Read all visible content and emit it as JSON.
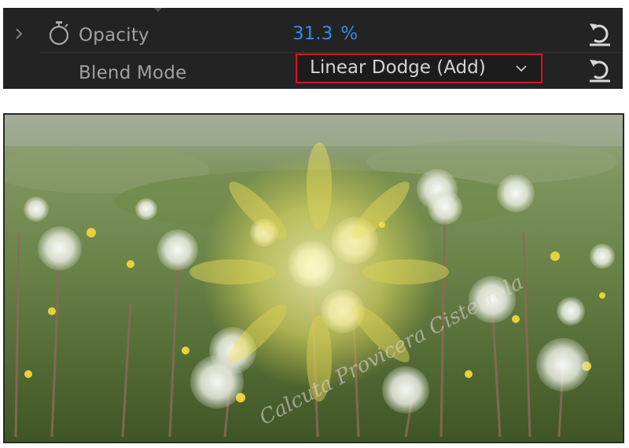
{
  "effect_controls": {
    "opacity": {
      "label": "Opacity",
      "value": "31.3",
      "unit": "%"
    },
    "blend_mode": {
      "label": "Blend Mode",
      "value": "Linear Dodge (Add)"
    }
  },
  "preview": {
    "watermark": "Calcuta Provicera Cisterrela"
  },
  "colors": {
    "panel_bg": "#232323",
    "value_blue": "#2f8cf0",
    "highlight_red": "#d7161e",
    "flower_yellow": "#f4e25a"
  },
  "icons": [
    "chevron-right-icon",
    "stopwatch-icon",
    "reset-icon",
    "chevron-down-icon"
  ]
}
